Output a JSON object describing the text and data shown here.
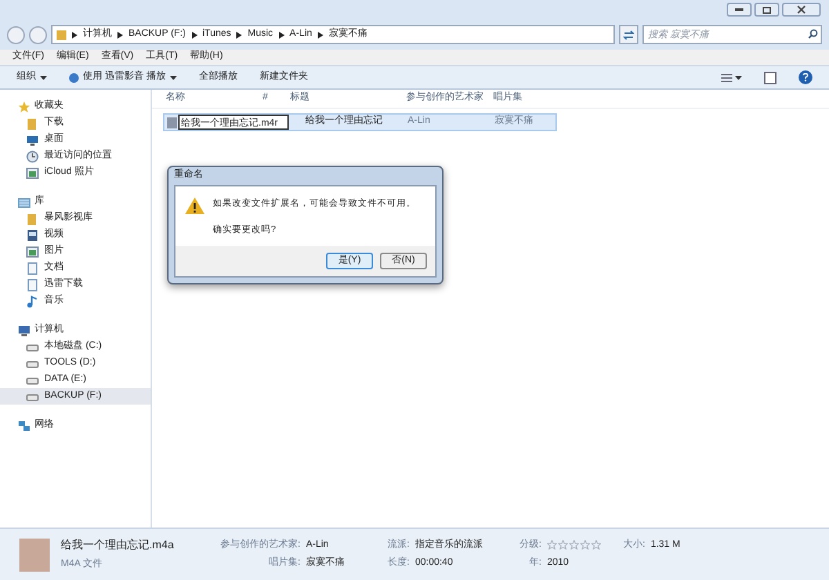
{
  "address_bar": {
    "crumbs": [
      "计算机",
      "BACKUP (F:)",
      "iTunes",
      "Music",
      "A-Lin",
      "寂寞不痛"
    ]
  },
  "search": {
    "placeholder": "搜索 寂寞不痛"
  },
  "menu": [
    "文件(F)",
    "编辑(E)",
    "查看(V)",
    "工具(T)",
    "帮助(H)"
  ],
  "toolbar": [
    {
      "kind": "dropdown",
      "label": "组织"
    },
    {
      "kind": "play",
      "label": "使用 迅雷影音 播放"
    },
    {
      "kind": "plain",
      "label": "全部播放"
    },
    {
      "kind": "plain",
      "label": "新建文件夹"
    }
  ],
  "sidebar": {
    "groups": [
      {
        "label": "收藏夹",
        "children": [
          {
            "label": "下载",
            "selected": false
          },
          {
            "label": "桌面",
            "selected": false
          },
          {
            "label": "最近访问的位置",
            "selected": false
          },
          {
            "label": "iCloud 照片",
            "selected": false
          }
        ]
      },
      {
        "label": "库",
        "children": [
          {
            "label": "暴风影视库",
            "selected": false
          },
          {
            "label": "视频",
            "selected": false
          },
          {
            "label": "图片",
            "selected": false
          },
          {
            "label": "文档",
            "selected": false
          },
          {
            "label": "迅雷下载",
            "selected": false
          },
          {
            "label": "音乐",
            "selected": false
          }
        ]
      },
      {
        "label": "计算机",
        "children": [
          {
            "label": "本地磁盘 (C:)",
            "selected": false
          },
          {
            "label": "TOOLS (D:)",
            "selected": false
          },
          {
            "label": "DATA (E:)",
            "selected": false
          },
          {
            "label": "BACKUP (F:)",
            "selected": true
          }
        ]
      },
      {
        "label": "网络"
      }
    ]
  },
  "table": {
    "columns": [
      "名称",
      "#",
      "标题",
      "参与创作的艺术家",
      "唱片集"
    ],
    "rows": [
      {
        "selected": true,
        "name_value": "给我一个理由忘记.m4r",
        "title": "给我一个理由忘记",
        "artist": "A-Lin",
        "album": "寂寞不痛"
      }
    ]
  },
  "dialog": {
    "title": "重命名",
    "message": "如果改变文件扩展名，可能会导致文件不可用。",
    "question": "确实要更改吗?",
    "buttons": [
      {
        "label": "是(Y)",
        "selected": true
      },
      {
        "label": "否(N)",
        "selected": false
      }
    ]
  },
  "details": {
    "file_name": "给我一个理由忘记.m4a",
    "file_type": "M4A 文件",
    "fields": [
      {
        "label": "参与创作的艺术家:",
        "value": "A-Lin"
      },
      {
        "label": "唱片集:",
        "value": "寂寞不痛"
      },
      {
        "label": "流派:",
        "value": "指定音乐的流派"
      },
      {
        "label": "长度:",
        "value": "00:00:40"
      }
    ],
    "rating": {
      "label": "分级:",
      "stars": 0
    },
    "year": {
      "label": "年:",
      "value": "2010"
    },
    "size": {
      "label": "大小:",
      "value": "1.31 M"
    }
  }
}
